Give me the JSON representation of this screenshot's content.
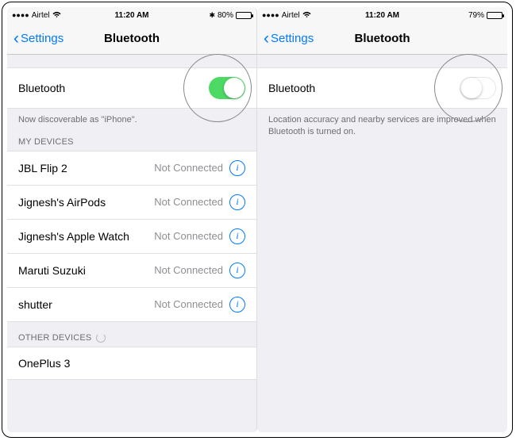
{
  "left": {
    "status": {
      "carrier": "Airtel",
      "time": "11:20 AM",
      "battery": "80%",
      "battery_pct": 80,
      "bt": "✱"
    },
    "nav": {
      "back": "Settings",
      "title": "Bluetooth"
    },
    "toggle": {
      "label": "Bluetooth",
      "on": true
    },
    "footer1": "Now discoverable as \"iPhone\".",
    "header_my": "MY DEVICES",
    "devices": [
      {
        "name": "JBL Flip 2",
        "status": "Not Connected"
      },
      {
        "name": "Jignesh's AirPods",
        "status": "Not Connected"
      },
      {
        "name": "Jignesh's Apple Watch",
        "status": "Not Connected"
      },
      {
        "name": "Maruti Suzuki",
        "status": "Not Connected"
      },
      {
        "name": "shutter",
        "status": "Not Connected"
      }
    ],
    "header_other": "OTHER DEVICES",
    "other": [
      {
        "name": "OnePlus 3"
      }
    ]
  },
  "right": {
    "status": {
      "carrier": "Airtel",
      "time": "11:20 AM",
      "battery": "79%",
      "battery_pct": 79
    },
    "nav": {
      "back": "Settings",
      "title": "Bluetooth"
    },
    "toggle": {
      "label": "Bluetooth",
      "on": false
    },
    "footer1": "Location accuracy and nearby services are improved when Bluetooth is turned on."
  }
}
